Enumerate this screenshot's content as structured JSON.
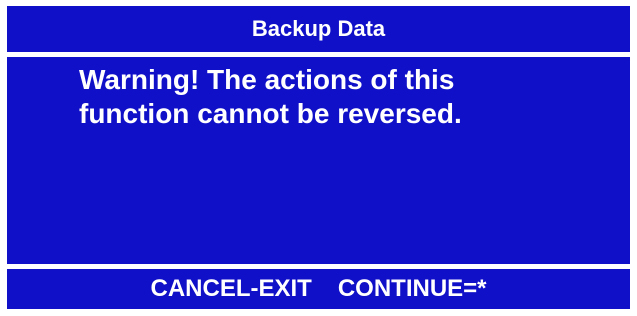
{
  "title": "Backup Data",
  "message": "Warning! The actions of this function cannot be reversed.",
  "footer": {
    "cancel_label": "CANCEL-EXIT",
    "continue_label": "CONTINUE=*"
  },
  "colors": {
    "panel_background": "#1010c8",
    "text": "#ffffff",
    "border": "#ffffff"
  }
}
